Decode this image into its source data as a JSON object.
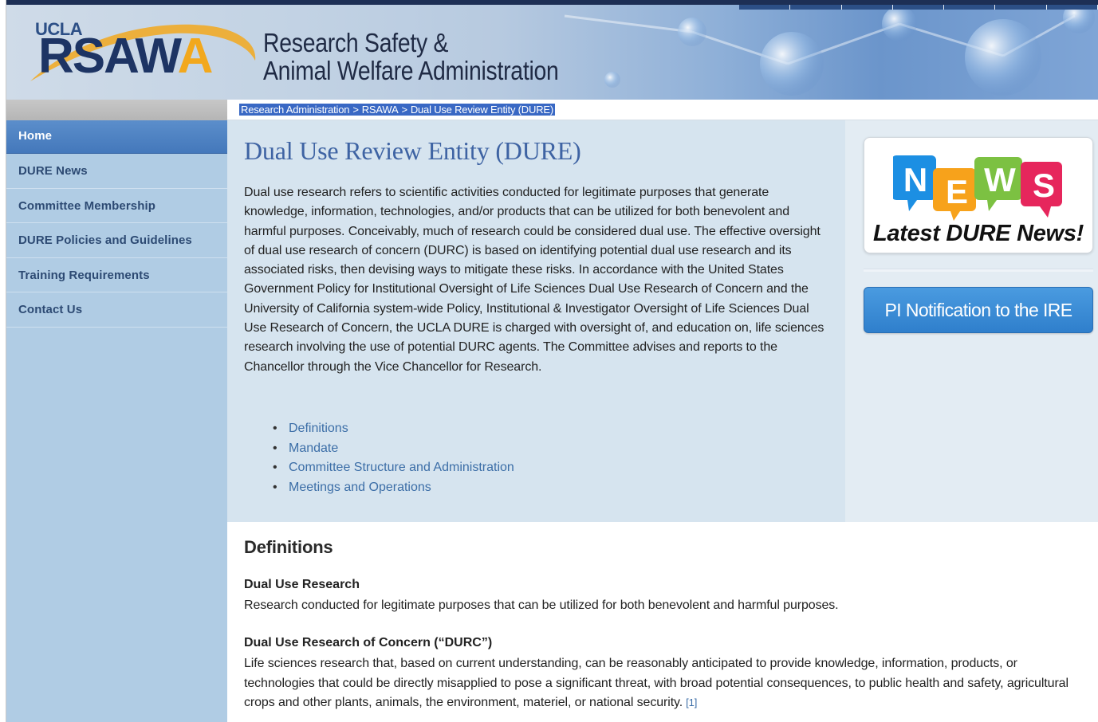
{
  "header": {
    "logo_ucla": "UCLA",
    "logo_rsawa_main": "RSAW",
    "logo_rsawa_last": "A",
    "title_line1": "Research Safety &",
    "title_line2": "Animal Welfare Administration"
  },
  "breadcrumb": {
    "items": [
      "Research Administration",
      "RSAWA",
      "Dual Use Review Entity (DURE)"
    ],
    "separator": ">"
  },
  "sidebar": {
    "items": [
      {
        "label": "Home",
        "active": true
      },
      {
        "label": "DURE News"
      },
      {
        "label": "Committee Membership"
      },
      {
        "label": "DURE Policies and Guidelines"
      },
      {
        "label": "Training Requirements"
      },
      {
        "label": "Contact Us"
      }
    ]
  },
  "main": {
    "title": "Dual Use Review Entity (DURE)",
    "intro": "Dual use research refers to scientific activities conducted for legitimate purposes that generate knowledge, information, technologies, and/or products that can be utilized for both benevolent and harmful purposes. Conceivably, much of research could be considered dual use. The effective oversight of dual use research of concern (DURC) is based on identifying potential dual use research and its associated risks, then devising ways to mitigate these risks. In accordance with the United States Government Policy for Institutional Oversight of Life Sciences Dual Use Research of Concern and the University of California system-wide Policy, Institutional & Investigator Oversight of Life Sciences Dual Use Research of Concern, the UCLA DURE is charged with oversight of, and education on, life sciences research involving the use of potential DURC agents. The Committee advises and reports to the Chancellor through the Vice Chancellor for Research.",
    "links": [
      "Definitions",
      "Mandate",
      "Committee Structure and Administration",
      "Meetings and Operations"
    ]
  },
  "right": {
    "news_letters": [
      "N",
      "E",
      "W",
      "S"
    ],
    "news_caption": "Latest DURE News!",
    "pi_button": "PI Notification to the IRE"
  },
  "definitions": {
    "heading": "Definitions",
    "items": [
      {
        "term": "Dual Use Research",
        "text": "Research conducted for legitimate purposes that can be utilized for both benevolent and harmful purposes."
      },
      {
        "term": "Dual Use Research of Concern (“DURC”)",
        "text": "Life sciences research that, based on current understanding, can be reasonably anticipated to provide knowledge, information, products, or technologies that could be directly misapplied to pose a significant threat, with broad potential consequences, to public health and safety, agricultural crops and other plants, animals, the environment, materiel, or national security.",
        "footnote": "[1]"
      }
    ]
  },
  "colors": {
    "sidebar_bg": "#b0cce4",
    "nav_active": "#4a7ec0",
    "intro_bg": "#d6e4ef",
    "heading_blue": "#3e63a3",
    "link_blue": "#3c6ea7",
    "button_blue": "#3a8ad6",
    "logo_navy": "#1d3464",
    "logo_orange": "#f2a81d"
  }
}
